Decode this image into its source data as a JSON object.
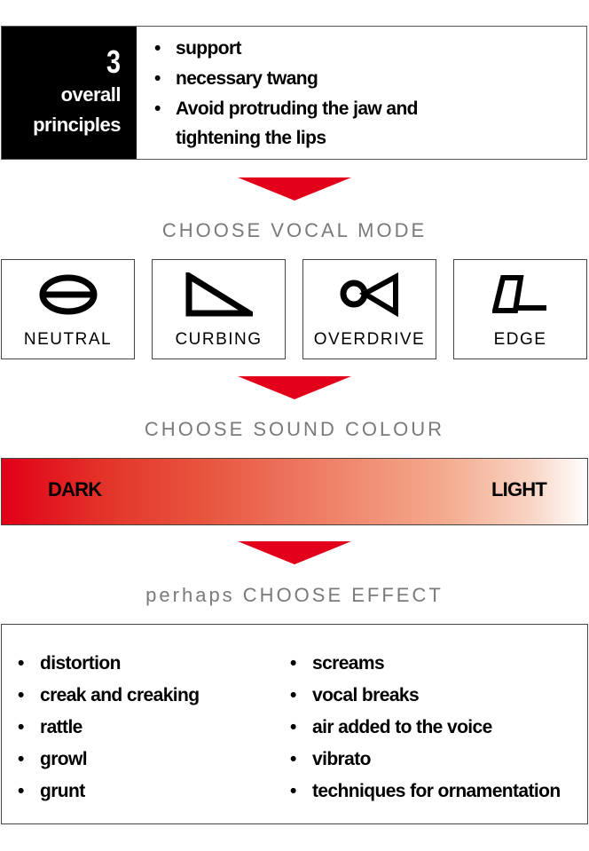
{
  "principles": {
    "number": "3",
    "caption_line1": "overall",
    "caption_line2": "principles",
    "items": [
      "support",
      "necessary twang",
      "Avoid protruding the jaw and tightening the lips"
    ]
  },
  "step1": {
    "title": "CHOOSE VOCAL MODE"
  },
  "modes": [
    {
      "label": "NEUTRAL",
      "icon": "neutral-circle-bar-icon"
    },
    {
      "label": "CURBING",
      "icon": "curbing-triangle-icon"
    },
    {
      "label": "OVERDRIVE",
      "icon": "overdrive-circle-triangle-icon"
    },
    {
      "label": "EDGE",
      "icon": "edge-parallelogram-icon"
    }
  ],
  "step2": {
    "title": "CHOOSE SOUND COLOUR"
  },
  "colour": {
    "dark_label": "DARK",
    "light_label": "LIGHT",
    "dark_color": "#e10017",
    "light_color": "#ffffff"
  },
  "step3": {
    "title": "perhaps CHOOSE EFFECT"
  },
  "effects": {
    "left": [
      "distortion",
      "creak and creaking",
      "rattle",
      "growl",
      "grunt"
    ],
    "right": [
      "screams",
      "vocal breaks",
      "air added to the voice",
      "vibrato",
      "techniques for ornamentation"
    ]
  },
  "colors": {
    "arrow": "#e2001a",
    "step_title": "#7a7a7a",
    "panel": "#000000"
  },
  "bullet": "•"
}
